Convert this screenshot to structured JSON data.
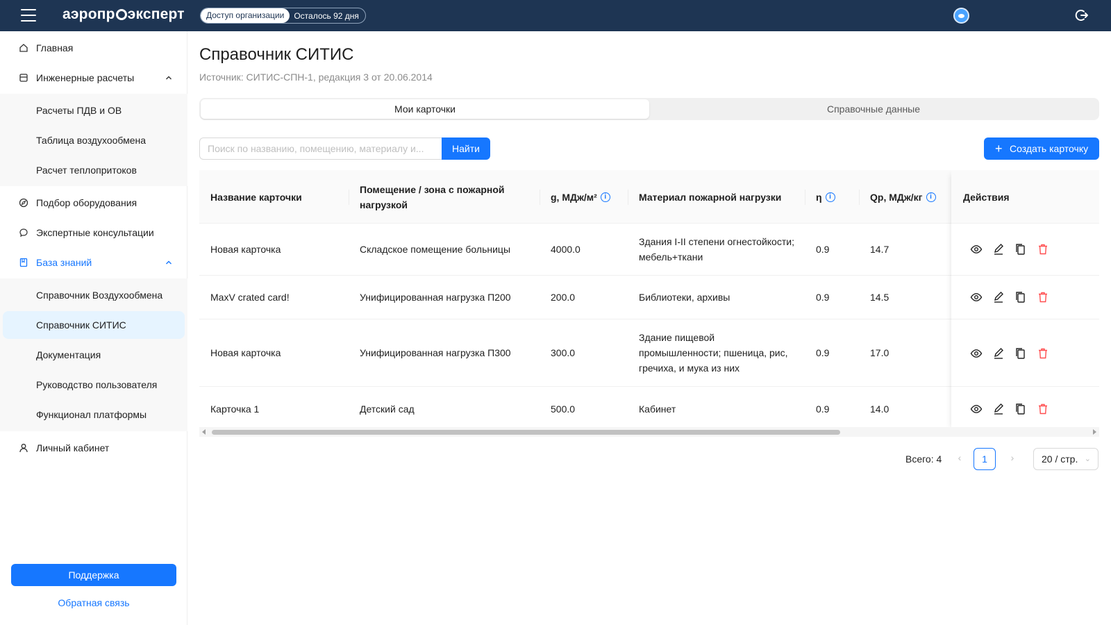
{
  "header": {
    "logo": "аэропр эксперт",
    "logo_left": "аэропр",
    "logo_right": "эксперт",
    "org_access": "Доступ организации",
    "days_left": "Осталось 92 дня"
  },
  "sidebar": {
    "home": "Главная",
    "engineering": "Инженерные расчеты",
    "engineering_items": [
      "Расчеты ПДВ и ОВ",
      "Таблица воздухообмена",
      "Расчет теплопритоков"
    ],
    "equipment": "Подбор оборудования",
    "consult": "Экспертные консультации",
    "knowledge": "База знаний",
    "knowledge_items": [
      "Справочник Воздухообмена",
      "Справочник СИТИС",
      "Документация",
      "Руководство пользователя",
      "Функционал платформы"
    ],
    "cabinet": "Личный кабинет",
    "support": "Поддержка",
    "feedback": "Обратная связь"
  },
  "page": {
    "title": "Справочник СИТИС",
    "source": "Источник: СИТИС-СПН-1, редакция 3 от 20.06.2014",
    "tabs": [
      "Мои карточки",
      "Справочные данные"
    ],
    "search_placeholder": "Поиск по названию, помещению, материалу и...",
    "find": "Найти",
    "create": "Создать карточку"
  },
  "table": {
    "columns": [
      "Название карточки",
      "Помещение / зона с пожарной нагрузкой",
      "g, МДж/м²",
      "Материал пожарной нагрузки",
      "η",
      "Qр, МДж/кг",
      "Действия"
    ],
    "rows": [
      {
        "name": "Новая карточка",
        "room": "Складское помещение больницы",
        "g": "4000.0",
        "material": "Здания I-II степени огнестойкости; мебель+ткани",
        "eta": "0.9",
        "q": "14.7"
      },
      {
        "name": "MaxV crated card!",
        "room": "Унифицированная нагрузка П200",
        "g": "200.0",
        "material": "Библиотеки, архивы",
        "eta": "0.9",
        "q": "14.5"
      },
      {
        "name": "Новая карточка",
        "room": "Унифицированная нагрузка П300",
        "g": "300.0",
        "material": "Здание пищевой промышленности; пшеница, рис, гречиха, и мука из них",
        "eta": "0.9",
        "q": "17.0"
      },
      {
        "name": "Карточка 1",
        "room": "Детский сад",
        "g": "500.0",
        "material": "Кабинет",
        "eta": "0.9",
        "q": "14.0"
      }
    ]
  },
  "pagination": {
    "total": "Всего: 4",
    "current": "1",
    "page_size": "20 / стр."
  },
  "colors": {
    "primary": "#1677ff",
    "header_bg": "#1e3553",
    "danger": "#ff4d4f"
  }
}
